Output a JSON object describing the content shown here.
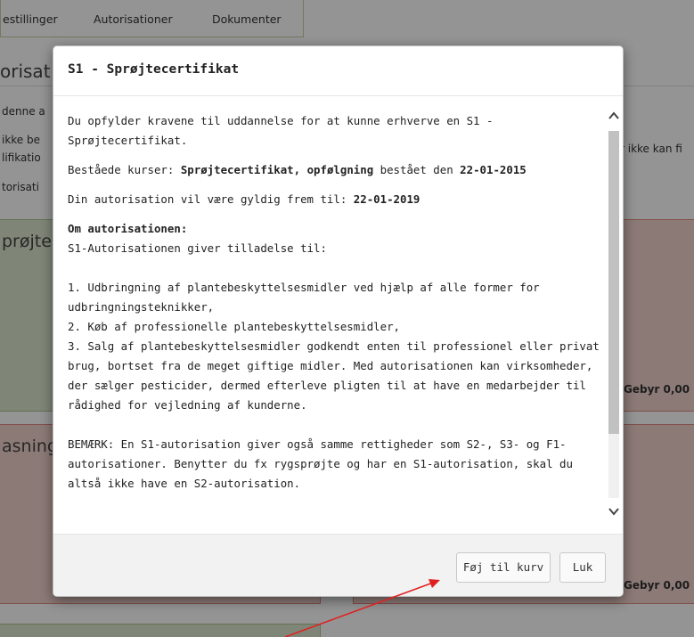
{
  "background": {
    "tabs": [
      "estillinger",
      "Autorisationer",
      "Dokumenter"
    ],
    "title": "orisat",
    "lines": [
      "denne a",
      "ikke be",
      "lifikatio",
      "torisati"
    ],
    "right_text": "r ikke kan fi",
    "panel_1_heading": "prøjte",
    "panel_2_heading": "asning",
    "fee_1": "Gebyr 0,00",
    "fee_2": "Gebyr 0,00"
  },
  "modal": {
    "title": "S1 - Sprøjtecertifikat",
    "intro": "Du opfylder kravene til uddannelse for at kunne erhverve en S1 - Sprøjtecertifikat.",
    "courses_label": "Beståede kurser: ",
    "course_name": "Sprøjtecertifikat, opfølgning",
    "passed_text": " bestået den ",
    "passed_date": "22-01-2015",
    "valid_label": "Din autorisation vil være gyldig frem til: ",
    "valid_date": "22-01-2019",
    "about_heading": "Om autorisationen:",
    "about_intro": "S1-Autorisationen giver tilladelse til:",
    "item_1": "1. Udbringning af plantebeskyttelsesmidler ved hjælp af alle former for udbringningsteknikker,",
    "item_2": "2. Køb af professionelle plantebeskyttelsesmidler,",
    "item_3": "3. Salg af plantebeskyttelsesmidler godkendt enten til professionel eller privat brug, bortset fra de meget giftige midler. Med autorisationen kan virksomheder, der sælger pesticider, dermed efterleve pligten til at have en medarbejder til rådighed for vejledning af kunderne.",
    "note": "BEMÆRK: En S1-autorisation giver også samme rettigheder som S2-, S3- og F1-autorisationer. Benytter du fx rygsprøjte og har en S1-autorisation, skal du altså ikke have en S2-autorisation.",
    "add_to_cart_label": "Føj til kurv",
    "close_label": "Luk"
  },
  "colors": {
    "overlay": "#000000",
    "panel_green": "#dbe7cf",
    "panel_red": "#f2d3cd",
    "arrow": "#e02020"
  },
  "icons": {
    "scroll_up": "chevron-up-icon",
    "scroll_down": "chevron-down-icon",
    "annotation": "red-arrow-icon"
  }
}
